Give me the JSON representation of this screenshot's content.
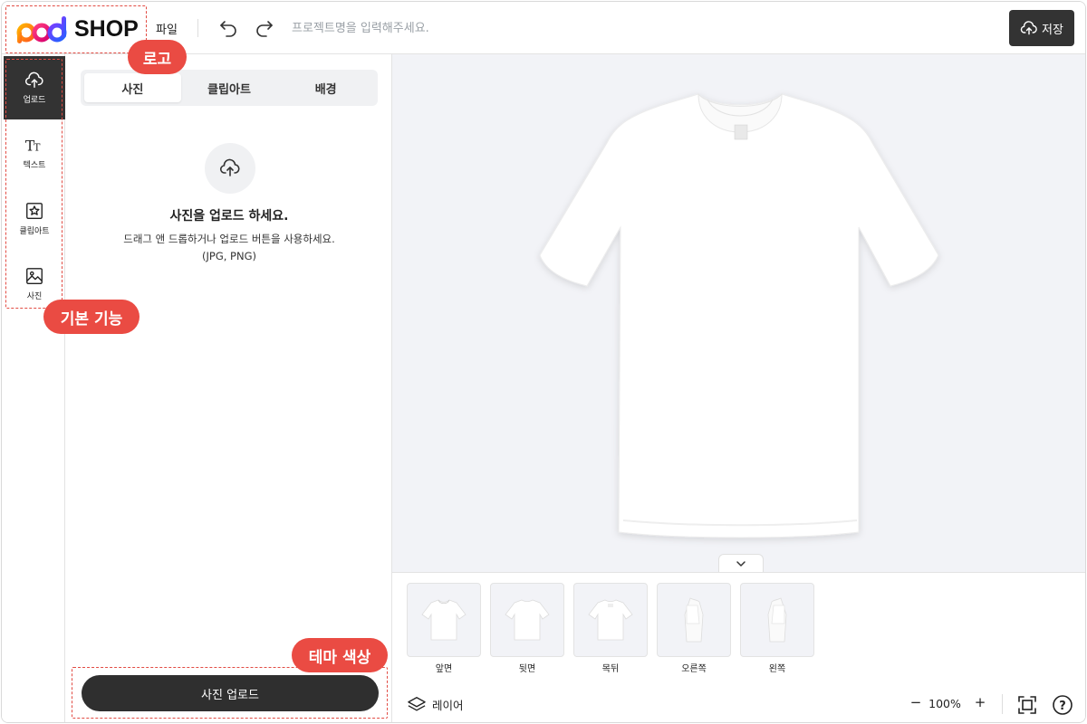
{
  "header": {
    "logo_text": "SHOP",
    "logo_mark": "pod",
    "file_menu": "파일",
    "project_placeholder": "프로젝트명을 입력해주세요.",
    "save_label": "저장"
  },
  "rail": {
    "items": [
      {
        "label": "업로드",
        "icon": "upload-cloud-icon"
      },
      {
        "label": "텍스트",
        "icon": "text-icon"
      },
      {
        "label": "클립아트",
        "icon": "clipart-star-icon"
      },
      {
        "label": "사진",
        "icon": "image-icon"
      }
    ]
  },
  "panel": {
    "tabs": [
      "사진",
      "클립아트",
      "배경"
    ],
    "upload_title": "사진을 업로드 하세요.",
    "upload_desc": "드래그 앤 드롭하거나 업로드 버튼을 사용하세요.",
    "upload_formats": "(JPG, PNG)",
    "upload_button": "사진 업로드"
  },
  "views": {
    "items": [
      "앞면",
      "뒷면",
      "목뒤",
      "오른쪽",
      "왼쪽"
    ]
  },
  "toolbar": {
    "layer_label": "레이어",
    "zoom_minus": "−",
    "zoom_value": "100%",
    "zoom_plus": "+",
    "help_label": "?"
  },
  "annotations": {
    "logo": "로고",
    "basic_features": "기본 기능",
    "theme_color": "테마 색상"
  },
  "colors": {
    "theme": "#333333",
    "callout": "#ea4b43",
    "canvas_bg": "#f2f3f7"
  }
}
